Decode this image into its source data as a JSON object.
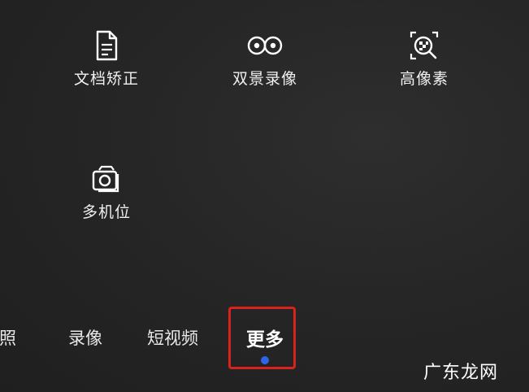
{
  "modes": {
    "doc_correction": {
      "label": "文档矫正",
      "icon": "document-icon"
    },
    "dual_view": {
      "label": "双景录像",
      "icon": "dual-lens-icon"
    },
    "high_res": {
      "label": "高像素",
      "icon": "high-resolution-icon"
    },
    "multi_cam": {
      "label": "多机位",
      "icon": "multi-camera-icon"
    }
  },
  "tabs": {
    "photo": "拍照",
    "record": "录像",
    "short_video": "短视频",
    "more": "更多"
  },
  "active_tab": "更多",
  "colors": {
    "highlight_border": "#d8221e",
    "active_dot": "#2f63e8"
  },
  "watermark": "广东龙网"
}
